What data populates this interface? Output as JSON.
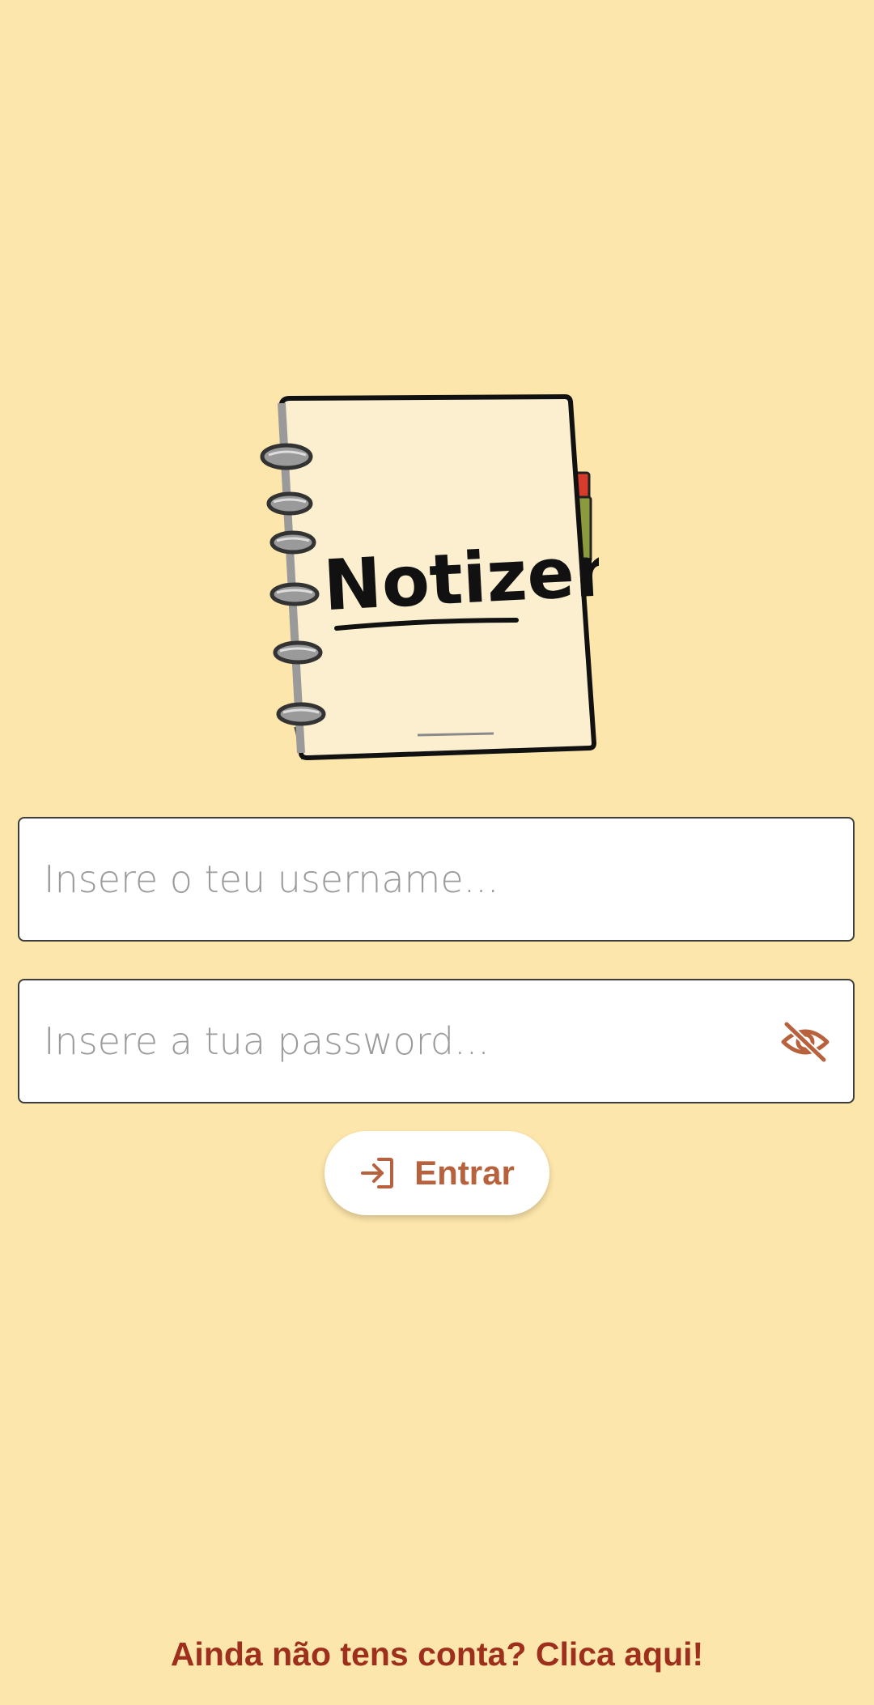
{
  "logo": {
    "title": "Notizen"
  },
  "login_form": {
    "username_placeholder": "Insere o teu username...",
    "password_placeholder": "Insere a tua password...",
    "submit_label": "Entrar",
    "password_toggle_icon": "eye-off-icon",
    "submit_icon": "login-icon"
  },
  "footer": {
    "signup_link": "Ainda não tens conta? Clica aqui!"
  },
  "colors": {
    "background": "#fde6ab",
    "accent": "#b8623d",
    "link": "#9e2f1c"
  }
}
